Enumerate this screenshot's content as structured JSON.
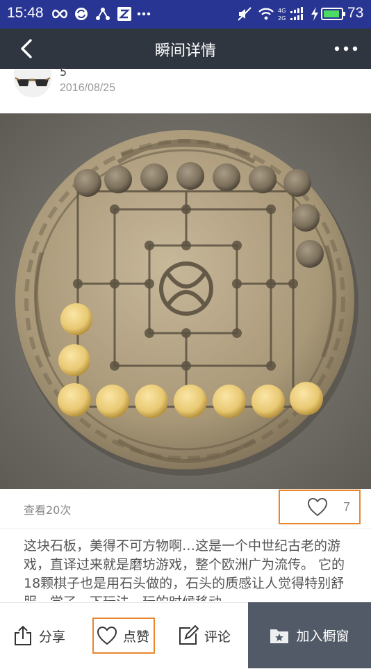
{
  "status_bar": {
    "time": "15:48",
    "battery": "73",
    "icons": [
      "infinity-icon",
      "sync-icon",
      "network-share-icon",
      "z-app-icon",
      "more-dots-icon",
      "mute-icon",
      "wifi-icon",
      "signal-icon",
      "charging-icon",
      "battery-icon"
    ],
    "network_labels": [
      "4G",
      "2G"
    ]
  },
  "nav": {
    "title": "瞬间详情",
    "back_icon": "back-arrow-icon",
    "more_icon": "more-dots-icon"
  },
  "author": {
    "name": "5",
    "date": "2016/08/25"
  },
  "post": {
    "views": "查看20次",
    "like_count": "7",
    "description": "这块石板，美得不可方物啊…这是一个中世纪古老的游戏，直译过来就是磨坊游戏，整个欧洲广为流传。 它的18颗棋子也是用石头做的，石头的质感让人觉得特别舒服，学了一下玩法，玩的时候移动"
  },
  "bottom_bar": {
    "share": "分享",
    "like": "点赞",
    "comment": "评论",
    "add_window": "加入橱窗"
  },
  "colors": {
    "status_bar": "#283593",
    "nav_bar": "#2f3640",
    "highlight": "#e8862e",
    "window_button": "#515a66"
  }
}
